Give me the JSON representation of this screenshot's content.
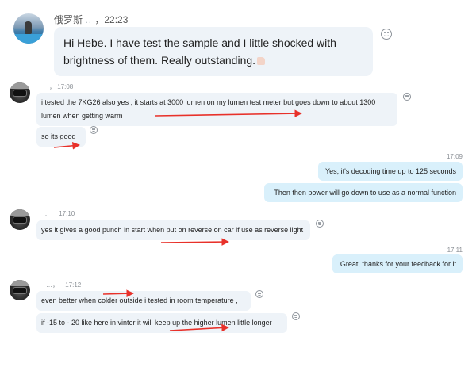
{
  "header": {
    "sender_name": "俄罗斯",
    "sender_blurred": "  ..",
    "time": "，22:23"
  },
  "messages": {
    "m1": "Hi Hebe.  I have test the sample and I little shocked with brightness of them. Really outstanding.",
    "m1_emoji": "thumbs-up-emoji",
    "group1_time": "17:08",
    "group1_prefix": "，",
    "m2": "i tested the 7KG26 also yes  , it starts at 3000 lumen on my lumen test meter but goes down to about 1300 lumen when getting warm",
    "m3": "so its good",
    "out1_time": "17:09",
    "out1": "Yes, it's decoding time up to 125 seconds",
    "out2": "Then then power will go down to use as a normal function",
    "group2_time": "17:10",
    "group2_prefix": "…",
    "m4": "yes it gives a good punch in start when put on reverse on car if use as reverse light",
    "out3_time": "17:11",
    "out3": "Great, thanks for your feedback for it",
    "group3_time": "17:12",
    "group3_prefix": "…，",
    "m5": "even better when colder outside i tested in room temperature ,",
    "m6": "if -15 to - 20 like here in vinter it will keep up the higher lumen little longer"
  },
  "colors": {
    "incoming_bubble": "#eef3f8",
    "outgoing_bubble": "#d9f0fb",
    "annotation_arrow": "#e8312a"
  },
  "icons": {
    "reaction": "smiley-face-icon",
    "annotation": "red-arrow-icon"
  }
}
